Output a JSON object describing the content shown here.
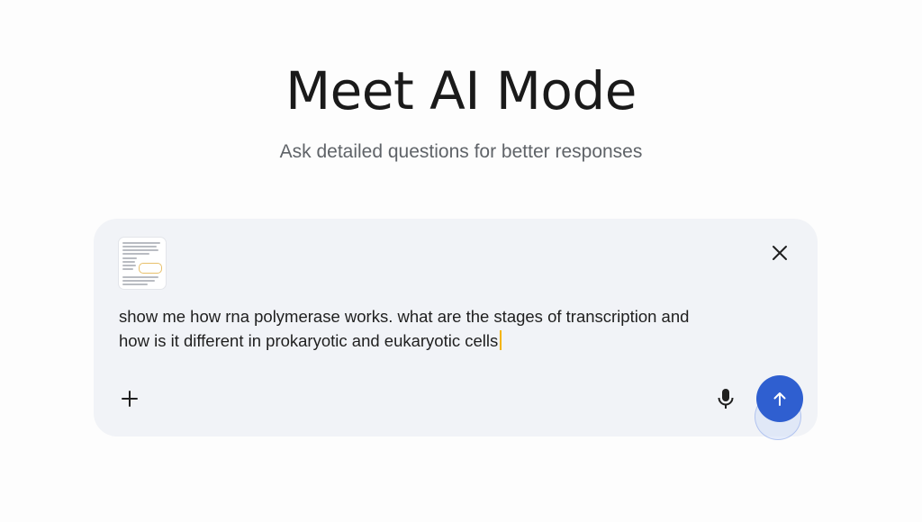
{
  "hero": {
    "title": "Meet AI Mode",
    "subtitle": "Ask detailed questions for better responses"
  },
  "composer": {
    "attachment": {
      "type": "document-thumbnail",
      "icon": "document-icon"
    },
    "query_line_1": "show me how rna polymerase works. what are the stages of transcription and",
    "query_line_2": "how is it different in prokaryotic and eukaryotic cells",
    "icons": {
      "close": "close-icon",
      "add": "plus-icon",
      "mic": "microphone-icon",
      "send": "arrow-up-icon"
    }
  },
  "colors": {
    "background": "#fdfdfd",
    "composer_bg": "#f1f3f7",
    "send_button": "#2f5fd0",
    "caret": "#f4b400",
    "subtitle": "#5f6368"
  }
}
